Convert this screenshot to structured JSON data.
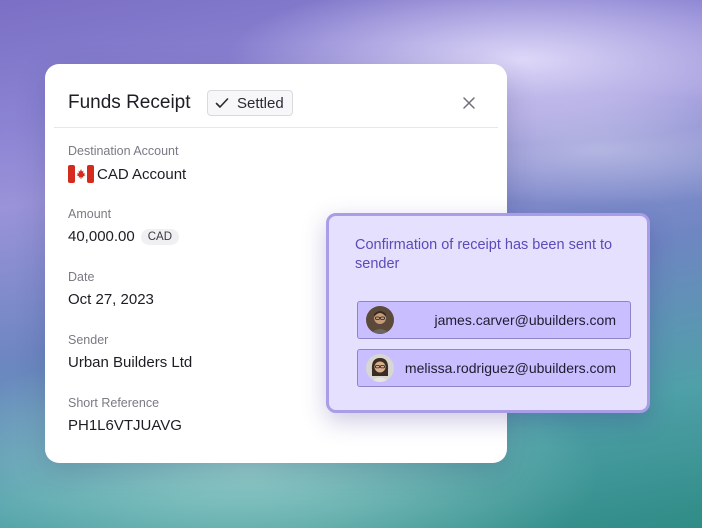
{
  "receipt": {
    "title": "Funds Receipt",
    "status": "Settled",
    "fields": {
      "destination_label": "Destination Account",
      "destination_value": "CAD Account",
      "amount_label": "Amount",
      "amount_value": "40,000.00",
      "amount_currency": "CAD",
      "date_label": "Date",
      "date_value": "Oct 27, 2023",
      "sender_label": "Sender",
      "sender_value": "Urban Builders Ltd",
      "reference_label": "Short Reference",
      "reference_value": "PH1L6VTJUAVG"
    },
    "icons": {
      "status": "check-icon",
      "close": "close-icon",
      "flag": "canada-flag-icon"
    }
  },
  "notification": {
    "message": "Confirmation of receipt has been sent to sender",
    "recipients": [
      {
        "email": "james.carver@ubuilders.com",
        "avatar": "avatar-james"
      },
      {
        "email": "melissa.rodriguez@ubuilders.com",
        "avatar": "avatar-melissa"
      }
    ]
  },
  "colors": {
    "accent": "#5a4bb8",
    "panel_bg": "#e6e0ff",
    "email_bg": "#c9beff",
    "flag_red": "#d52b1e"
  }
}
